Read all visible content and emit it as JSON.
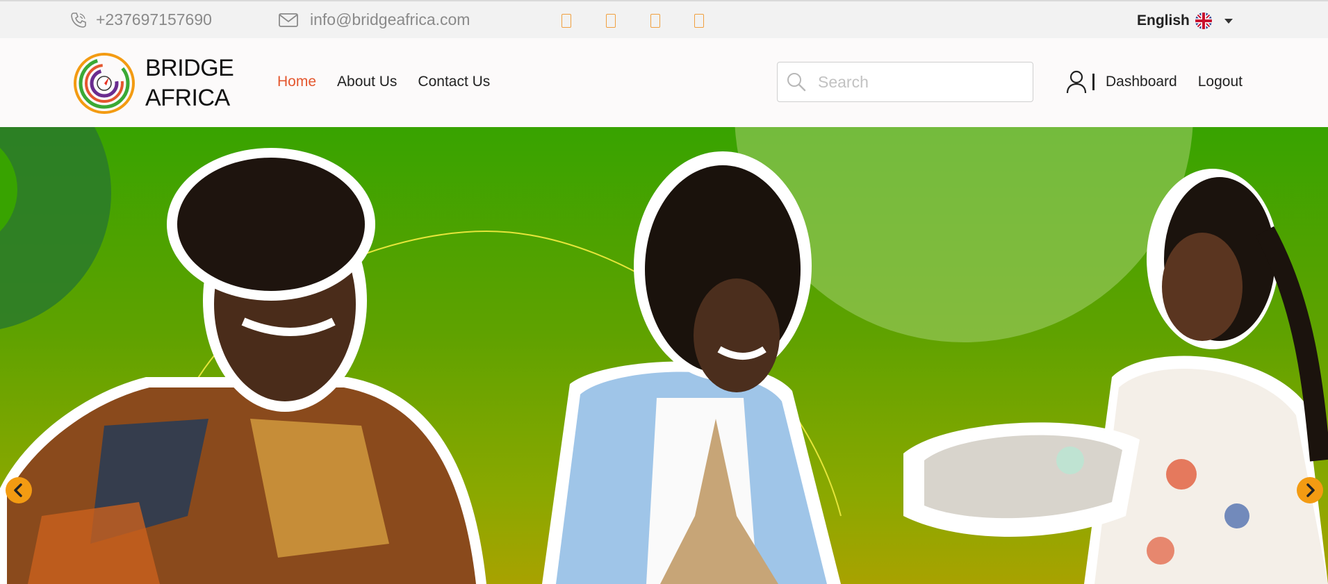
{
  "topbar": {
    "phone": "+237697157690",
    "email": "info@bridgeafrica.com",
    "social_icons": [
      "facebook-icon",
      "twitter-icon",
      "instagram-icon",
      "linkedin-icon"
    ],
    "language": "English"
  },
  "header": {
    "logo_line1": "BRIDGE",
    "logo_line2": "AFRICA",
    "nav": {
      "home": "Home",
      "about": "About Us",
      "contact": "Contact Us"
    },
    "search_placeholder": "Search",
    "dashboard": "Dashboard",
    "logout": "Logout"
  },
  "colors": {
    "accent": "#e4572e",
    "arrow": "#f39b12",
    "hero_green": "#38a300"
  }
}
